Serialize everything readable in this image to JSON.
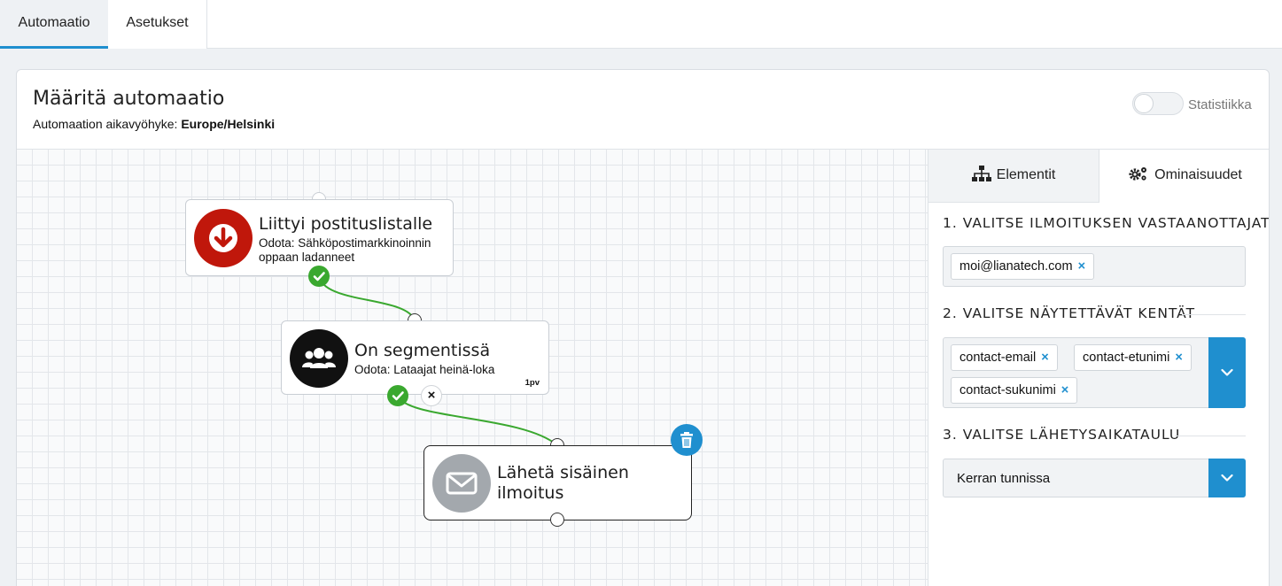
{
  "tabs": {
    "automation": "Automaatio",
    "settings": "Asetukset"
  },
  "header": {
    "title": "Määritä automaatio",
    "timezone_label": "Automaation aikavyöhyke:",
    "timezone_value": "Europe/Helsinki",
    "statistics_label": "Statistiikka",
    "statistics_on": false
  },
  "nodes": {
    "joined": {
      "title": "Liittyi postituslistalle",
      "subtitle_line1": "Odota: Sähköpostimarkkinoinnin",
      "subtitle_line2": "oppaan ladanneet",
      "icon": "arrow-down-circle-icon",
      "color": "#c0170b"
    },
    "segment": {
      "title": "On segmentissä",
      "subtitle": "Odota: Lataajat heinä-loka",
      "badge": "1pv",
      "icon": "users-icon",
      "color": "#111111"
    },
    "notify": {
      "title_line1": "Lähetä sisäinen",
      "title_line2": "ilmoitus",
      "icon": "envelope-icon",
      "color": "#a3a8ad"
    }
  },
  "panel": {
    "tab_elements": "Elementit",
    "tab_properties": "Ominaisuudet",
    "section1": "1. VALITSE ILMOITUKSEN VASTAANOTTAJAT",
    "recipients": [
      "moi@lianatech.com"
    ],
    "section2": "2. VALITSE NÄYTETTÄVÄT KENTÄT",
    "fields": [
      "contact-email",
      "contact-etunimi",
      "contact-sukunimi"
    ],
    "section3": "3. VALITSE LÄHETYSAIKATAULU",
    "schedule": "Kerran tunnissa"
  },
  "colors": {
    "accent": "#1f8fcf",
    "success": "#3aa82f",
    "connector": "#3aa82f"
  }
}
